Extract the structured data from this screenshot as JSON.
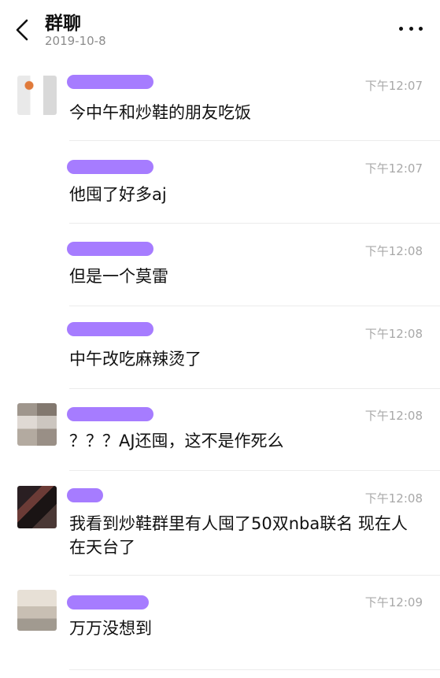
{
  "header": {
    "title": "群聊",
    "date": "2019-10-8"
  },
  "messages": [
    {
      "time": "下午12:07",
      "text": "今中午和炒鞋的朋友吃饭"
    },
    {
      "time": "下午12:07",
      "text": "他囤了好多aj"
    },
    {
      "time": "下午12:08",
      "text": "但是一个莫雷"
    },
    {
      "time": "下午12:08",
      "text": "中午改吃麻辣烫了"
    },
    {
      "time": "下午12:08",
      "text": "？？？AJ还囤，这不是作死么"
    },
    {
      "time": "下午12:08",
      "text": "我看到炒鞋群里有人囤了50双nba联名 现在人在天台了"
    },
    {
      "time": "下午12:09",
      "text": "万万没想到"
    }
  ],
  "colors": {
    "name_redaction": "#a67cff",
    "time_text": "#a8a8a8",
    "subtitle_text": "#8c8c8c"
  },
  "icons": {
    "back": "chevron-left-icon",
    "more": "more-dots-icon"
  }
}
